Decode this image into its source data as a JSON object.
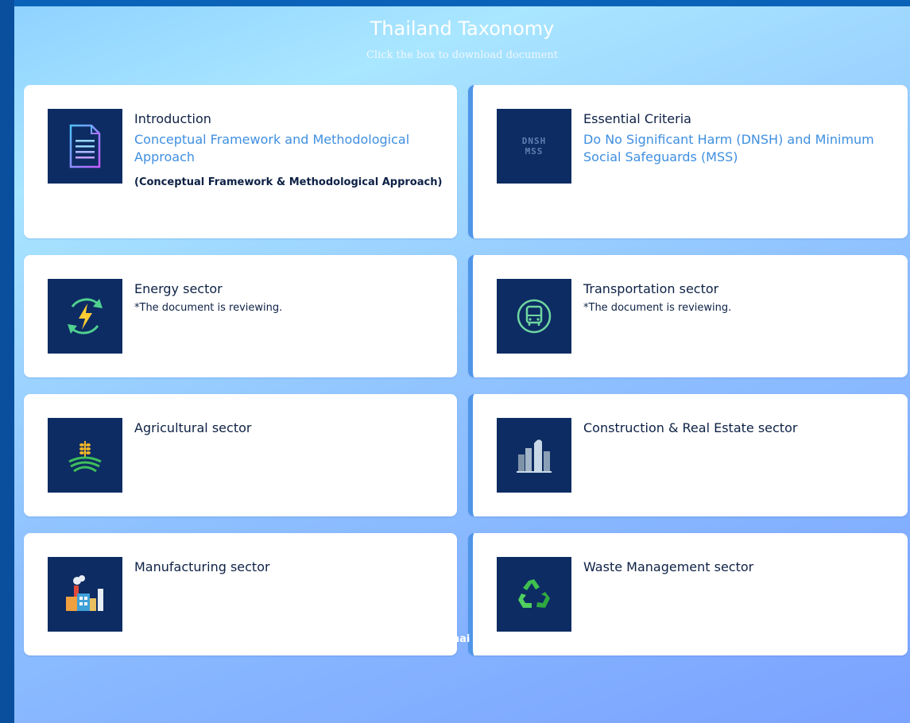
{
  "header": {
    "title": "Thailand Taxonomy",
    "subtitle": "Click the box to download document"
  },
  "cards": [
    {
      "title": "Introduction",
      "link": "Conceptual Framework and Methodological Approach",
      "note": "(Conceptual Framework & Methodological Approach)",
      "icon": "document-icon"
    },
    {
      "title": "Essential Criteria",
      "link": "Do No Significant Harm (DNSH) and Minimum Social Safeguards (MSS)",
      "icon_text": [
        "DNSH",
        "MSS"
      ],
      "icon": "dnsh-mss-icon"
    },
    {
      "title": "Energy sector",
      "status": "*The document is reviewing.",
      "icon": "energy-icon"
    },
    {
      "title": "Transportation sector",
      "status": "*The document is reviewing.",
      "icon": "bus-icon"
    },
    {
      "title": "Agricultural sector",
      "icon": "wheat-field-icon"
    },
    {
      "title": "Construction & Real Estate sector",
      "icon": "skyscraper-icon"
    },
    {
      "title": "Manufacturing sector",
      "icon": "factory-icon"
    },
    {
      "title": "Waste Management sector",
      "icon": "recycle-icon"
    }
  ],
  "footer": {
    "thai_label": "Thai version",
    "icon": "arrow-right-circle-icon"
  },
  "colors": {
    "tile_bg": "#0d2c63",
    "link": "#3f8fe0",
    "text": "#0d2145",
    "accent_border": "#4f95e8"
  }
}
